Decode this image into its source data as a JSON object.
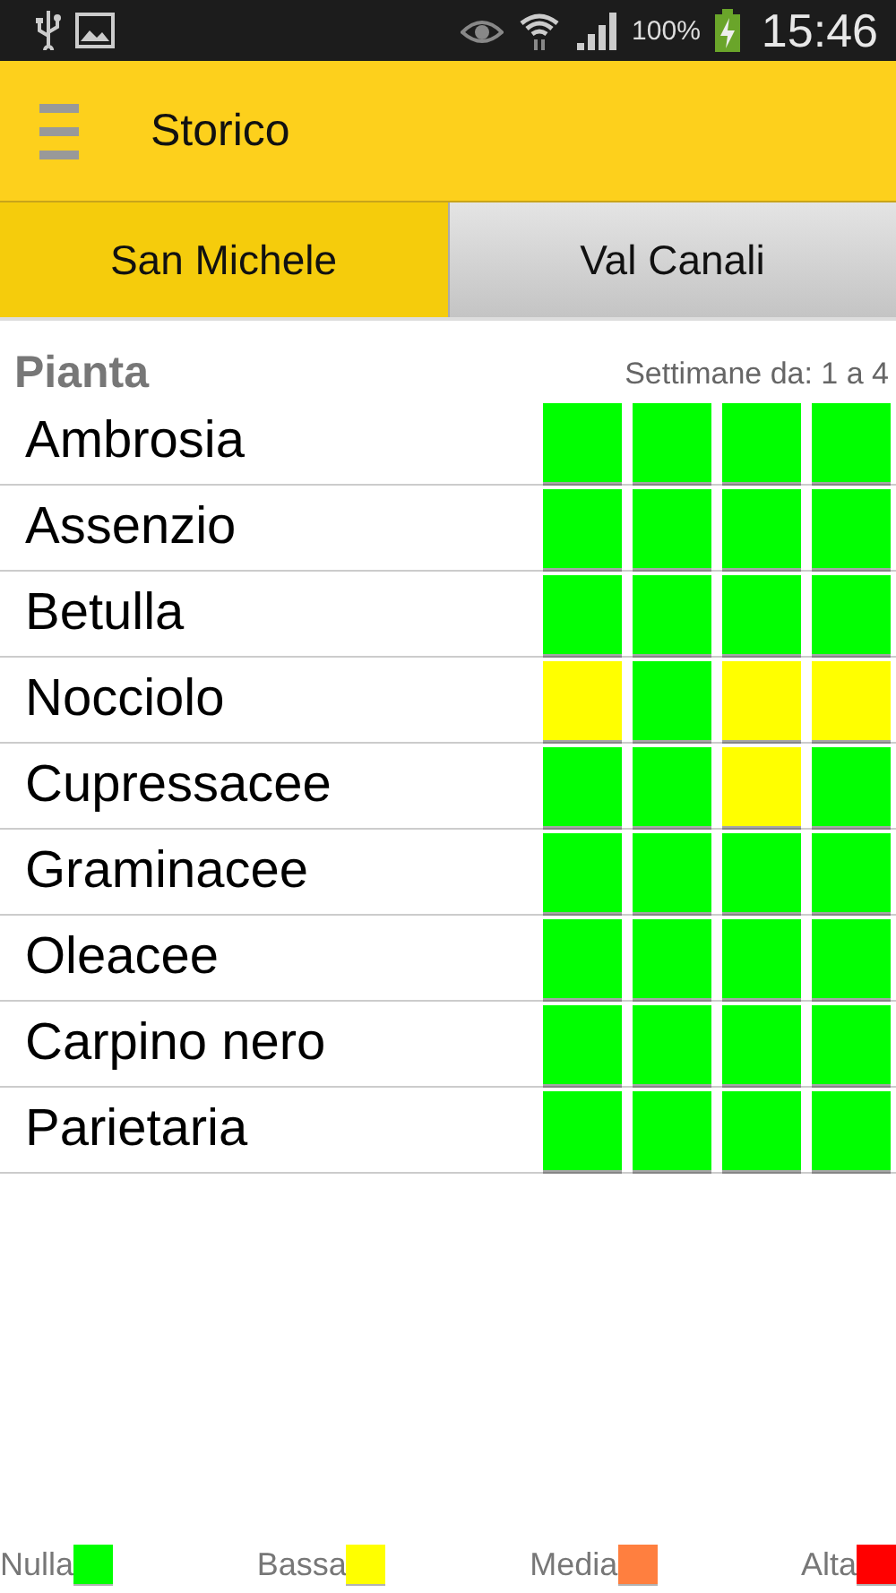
{
  "status_bar": {
    "battery": "100%",
    "time": "15:46"
  },
  "app_bar": {
    "title": "Storico"
  },
  "tabs": [
    {
      "label": "San Michele",
      "selected": true
    },
    {
      "label": "Val Canali",
      "selected": false
    }
  ],
  "table": {
    "header": "Pianta",
    "weeks_label": "Settimane da: 1 a 4",
    "rows": [
      {
        "name": "Ambrosia",
        "weeks": [
          {
            "color": "#00ff00"
          },
          {
            "color": "#00ff00"
          },
          {
            "color": "#00ff00"
          },
          {
            "color": "#00ff00"
          }
        ]
      },
      {
        "name": "Assenzio",
        "weeks": [
          {
            "color": "#00ff00"
          },
          {
            "color": "#00ff00"
          },
          {
            "color": "#00ff00"
          },
          {
            "color": "#00ff00"
          }
        ]
      },
      {
        "name": "Betulla",
        "weeks": [
          {
            "color": "#00ff00"
          },
          {
            "color": "#00ff00"
          },
          {
            "color": "#00ff00"
          },
          {
            "color": "#00ff00"
          }
        ]
      },
      {
        "name": "Nocciolo",
        "weeks": [
          {
            "color": "#ffff00"
          },
          {
            "color": "#00ff00"
          },
          {
            "color": "#ffff00"
          },
          {
            "color": "#ffff00"
          }
        ]
      },
      {
        "name": "Cupressacee",
        "weeks": [
          {
            "color": "#00ff00"
          },
          {
            "color": "#00ff00"
          },
          {
            "color": "#ffff00"
          },
          {
            "color": "#00ff00"
          }
        ]
      },
      {
        "name": "Graminacee",
        "weeks": [
          {
            "color": "#00ff00"
          },
          {
            "color": "#00ff00"
          },
          {
            "color": "#00ff00"
          },
          {
            "color": "#00ff00"
          }
        ]
      },
      {
        "name": "Oleacee",
        "weeks": [
          {
            "color": "#00ff00"
          },
          {
            "color": "#00ff00"
          },
          {
            "color": "#00ff00"
          },
          {
            "color": "#00ff00"
          }
        ]
      },
      {
        "name": "Carpino nero",
        "weeks": [
          {
            "color": "#00ff00"
          },
          {
            "color": "#00ff00"
          },
          {
            "color": "#00ff00"
          },
          {
            "color": "#00ff00"
          }
        ]
      },
      {
        "name": "Parietaria",
        "weeks": [
          {
            "color": "#00ff00"
          },
          {
            "color": "#00ff00"
          },
          {
            "color": "#00ff00"
          },
          {
            "color": "#00ff00"
          }
        ]
      }
    ]
  },
  "legend": [
    {
      "label": "Nulla",
      "color": "#00ff00"
    },
    {
      "label": "Bassa",
      "color": "#ffff00"
    },
    {
      "label": "Media",
      "color": "#ff7f3f"
    },
    {
      "label": "Alta",
      "color": "#ff0000"
    }
  ]
}
